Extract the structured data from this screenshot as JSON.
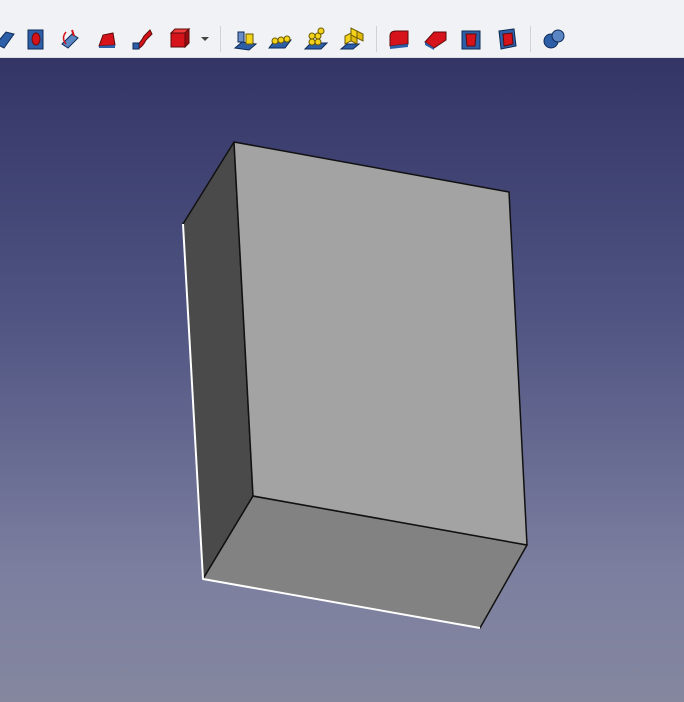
{
  "window": {
    "width": 684,
    "height": 702
  },
  "toolbar": {
    "groups": [
      {
        "name": "feature-tools",
        "icons": [
          "pad-icon",
          "pocket-icon",
          "revolution-icon",
          "additive-loft-icon",
          "additive-pipe-icon",
          "additive-primitive-icon",
          "dropdown-arrow-icon"
        ]
      },
      {
        "name": "pattern-tools",
        "icons": [
          "mirrored-icon",
          "linear-pattern-icon",
          "polar-pattern-icon",
          "multitransform-icon"
        ]
      },
      {
        "name": "dressup-tools",
        "icons": [
          "fillet-icon",
          "chamfer-icon",
          "draft-icon",
          "thickness-icon"
        ]
      },
      {
        "name": "boolean-tools",
        "icons": [
          "boolean-icon"
        ]
      }
    ]
  },
  "viewport": {
    "background_top": "#333566",
    "background_bottom": "#85879f",
    "model": {
      "type": "box",
      "face_colors": {
        "front": "#a3a3a3",
        "left": "#4a4a4a",
        "bottom": "#828282"
      },
      "edge_color": "#111111",
      "selected_edge_color": "#ffffff"
    }
  }
}
